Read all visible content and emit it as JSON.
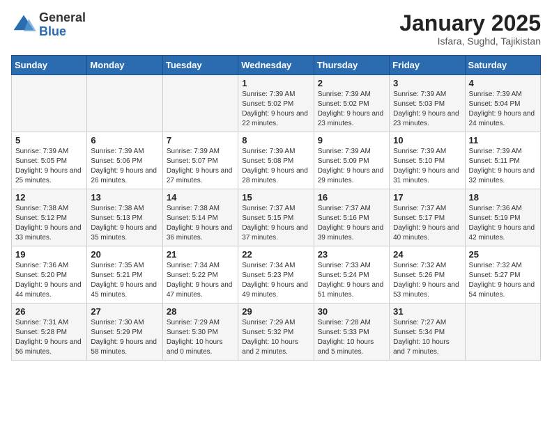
{
  "logo": {
    "general": "General",
    "blue": "Blue"
  },
  "title": "January 2025",
  "subtitle": "Isfara, Sughd, Tajikistan",
  "days_of_week": [
    "Sunday",
    "Monday",
    "Tuesday",
    "Wednesday",
    "Thursday",
    "Friday",
    "Saturday"
  ],
  "weeks": [
    [
      {
        "day": null,
        "info": null
      },
      {
        "day": null,
        "info": null
      },
      {
        "day": null,
        "info": null
      },
      {
        "day": "1",
        "info": "Sunrise: 7:39 AM\nSunset: 5:02 PM\nDaylight: 9 hours\nand 22 minutes."
      },
      {
        "day": "2",
        "info": "Sunrise: 7:39 AM\nSunset: 5:02 PM\nDaylight: 9 hours\nand 23 minutes."
      },
      {
        "day": "3",
        "info": "Sunrise: 7:39 AM\nSunset: 5:03 PM\nDaylight: 9 hours\nand 23 minutes."
      },
      {
        "day": "4",
        "info": "Sunrise: 7:39 AM\nSunset: 5:04 PM\nDaylight: 9 hours\nand 24 minutes."
      }
    ],
    [
      {
        "day": "5",
        "info": "Sunrise: 7:39 AM\nSunset: 5:05 PM\nDaylight: 9 hours\nand 25 minutes."
      },
      {
        "day": "6",
        "info": "Sunrise: 7:39 AM\nSunset: 5:06 PM\nDaylight: 9 hours\nand 26 minutes."
      },
      {
        "day": "7",
        "info": "Sunrise: 7:39 AM\nSunset: 5:07 PM\nDaylight: 9 hours\nand 27 minutes."
      },
      {
        "day": "8",
        "info": "Sunrise: 7:39 AM\nSunset: 5:08 PM\nDaylight: 9 hours\nand 28 minutes."
      },
      {
        "day": "9",
        "info": "Sunrise: 7:39 AM\nSunset: 5:09 PM\nDaylight: 9 hours\nand 29 minutes."
      },
      {
        "day": "10",
        "info": "Sunrise: 7:39 AM\nSunset: 5:10 PM\nDaylight: 9 hours\nand 31 minutes."
      },
      {
        "day": "11",
        "info": "Sunrise: 7:39 AM\nSunset: 5:11 PM\nDaylight: 9 hours\nand 32 minutes."
      }
    ],
    [
      {
        "day": "12",
        "info": "Sunrise: 7:38 AM\nSunset: 5:12 PM\nDaylight: 9 hours\nand 33 minutes."
      },
      {
        "day": "13",
        "info": "Sunrise: 7:38 AM\nSunset: 5:13 PM\nDaylight: 9 hours\nand 35 minutes."
      },
      {
        "day": "14",
        "info": "Sunrise: 7:38 AM\nSunset: 5:14 PM\nDaylight: 9 hours\nand 36 minutes."
      },
      {
        "day": "15",
        "info": "Sunrise: 7:37 AM\nSunset: 5:15 PM\nDaylight: 9 hours\nand 37 minutes."
      },
      {
        "day": "16",
        "info": "Sunrise: 7:37 AM\nSunset: 5:16 PM\nDaylight: 9 hours\nand 39 minutes."
      },
      {
        "day": "17",
        "info": "Sunrise: 7:37 AM\nSunset: 5:17 PM\nDaylight: 9 hours\nand 40 minutes."
      },
      {
        "day": "18",
        "info": "Sunrise: 7:36 AM\nSunset: 5:19 PM\nDaylight: 9 hours\nand 42 minutes."
      }
    ],
    [
      {
        "day": "19",
        "info": "Sunrise: 7:36 AM\nSunset: 5:20 PM\nDaylight: 9 hours\nand 44 minutes."
      },
      {
        "day": "20",
        "info": "Sunrise: 7:35 AM\nSunset: 5:21 PM\nDaylight: 9 hours\nand 45 minutes."
      },
      {
        "day": "21",
        "info": "Sunrise: 7:34 AM\nSunset: 5:22 PM\nDaylight: 9 hours\nand 47 minutes."
      },
      {
        "day": "22",
        "info": "Sunrise: 7:34 AM\nSunset: 5:23 PM\nDaylight: 9 hours\nand 49 minutes."
      },
      {
        "day": "23",
        "info": "Sunrise: 7:33 AM\nSunset: 5:24 PM\nDaylight: 9 hours\nand 51 minutes."
      },
      {
        "day": "24",
        "info": "Sunrise: 7:32 AM\nSunset: 5:26 PM\nDaylight: 9 hours\nand 53 minutes."
      },
      {
        "day": "25",
        "info": "Sunrise: 7:32 AM\nSunset: 5:27 PM\nDaylight: 9 hours\nand 54 minutes."
      }
    ],
    [
      {
        "day": "26",
        "info": "Sunrise: 7:31 AM\nSunset: 5:28 PM\nDaylight: 9 hours\nand 56 minutes."
      },
      {
        "day": "27",
        "info": "Sunrise: 7:30 AM\nSunset: 5:29 PM\nDaylight: 9 hours\nand 58 minutes."
      },
      {
        "day": "28",
        "info": "Sunrise: 7:29 AM\nSunset: 5:30 PM\nDaylight: 10 hours\nand 0 minutes."
      },
      {
        "day": "29",
        "info": "Sunrise: 7:29 AM\nSunset: 5:32 PM\nDaylight: 10 hours\nand 2 minutes."
      },
      {
        "day": "30",
        "info": "Sunrise: 7:28 AM\nSunset: 5:33 PM\nDaylight: 10 hours\nand 5 minutes."
      },
      {
        "day": "31",
        "info": "Sunrise: 7:27 AM\nSunset: 5:34 PM\nDaylight: 10 hours\nand 7 minutes."
      },
      {
        "day": null,
        "info": null
      }
    ]
  ]
}
